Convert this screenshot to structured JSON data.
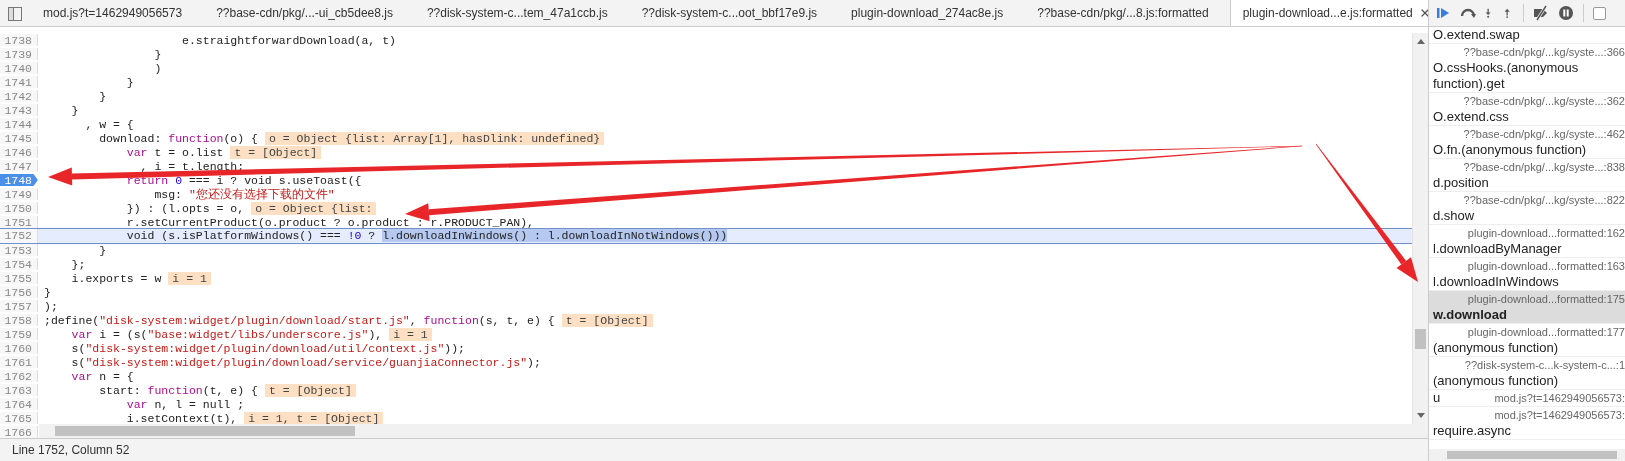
{
  "tabs": [
    {
      "label": "mod.js?t=1462949056573",
      "selected": false
    },
    {
      "label": "??base-cdn/pkg/...-ui_cb5dee8.js",
      "selected": false
    },
    {
      "label": "??disk-system-c...tem_47a1ccb.js",
      "selected": false
    },
    {
      "label": "??disk-system-c...oot_bbf17e9.js",
      "selected": false
    },
    {
      "label": "plugin-download_274ac8e.js",
      "selected": false
    },
    {
      "label": "??base-cdn/pkg/...8.js:formatted",
      "selected": false
    },
    {
      "label": "plugin-download...e.js:formatted",
      "selected": true
    }
  ],
  "code_lines": [
    {
      "number": "1738",
      "breakpoint": false,
      "current": false,
      "segments": [
        {
          "kind": "text",
          "text": "                    e.straightforwardDownload(a, t)"
        }
      ]
    },
    {
      "number": "1739",
      "breakpoint": false,
      "current": false,
      "segments": [
        {
          "kind": "text",
          "text": "                }"
        }
      ]
    },
    {
      "number": "1740",
      "breakpoint": false,
      "current": false,
      "segments": [
        {
          "kind": "text",
          "text": "                )"
        }
      ]
    },
    {
      "number": "1741",
      "breakpoint": false,
      "current": false,
      "segments": [
        {
          "kind": "text",
          "text": "            }"
        }
      ]
    },
    {
      "number": "1742",
      "breakpoint": false,
      "current": false,
      "segments": [
        {
          "kind": "text",
          "text": "        }"
        }
      ]
    },
    {
      "number": "1743",
      "breakpoint": false,
      "current": false,
      "segments": [
        {
          "kind": "text",
          "text": "    }"
        }
      ]
    },
    {
      "number": "1744",
      "breakpoint": false,
      "current": false,
      "segments": [
        {
          "kind": "text",
          "text": "      , w = {"
        }
      ]
    },
    {
      "number": "1745",
      "breakpoint": false,
      "current": false,
      "segments": [
        {
          "kind": "text",
          "text": "        download: "
        },
        {
          "kind": "keyword",
          "text": "function"
        },
        {
          "kind": "text",
          "text": "(o) {"
        },
        {
          "kind": "value",
          "text": "o = Object {list: Array[1], hasDlink: undefined}"
        }
      ]
    },
    {
      "number": "1746",
      "breakpoint": false,
      "current": false,
      "segments": [
        {
          "kind": "keyword",
          "text": "            var"
        },
        {
          "kind": "text",
          "text": " t = o.list"
        },
        {
          "kind": "value",
          "text": "t = [Object]"
        }
      ]
    },
    {
      "number": "1747",
      "breakpoint": false,
      "current": false,
      "segments": [
        {
          "kind": "text",
          "text": "              , i = t.length;"
        }
      ]
    },
    {
      "number": "1748",
      "breakpoint": true,
      "current": false,
      "segments": [
        {
          "kind": "keyword",
          "text": "            return"
        },
        {
          "kind": "number",
          "text": " 0"
        },
        {
          "kind": "text",
          "text": " === i ? void s.useToast({"
        }
      ]
    },
    {
      "number": "1749",
      "breakpoint": false,
      "current": false,
      "segments": [
        {
          "kind": "text",
          "text": "                msg: "
        },
        {
          "kind": "string",
          "text": "\"您还没有选择下载的文件\""
        }
      ]
    },
    {
      "number": "1750",
      "breakpoint": false,
      "current": false,
      "segments": [
        {
          "kind": "text",
          "text": "            }) : (l.opts = o,"
        },
        {
          "kind": "value",
          "text": "o = Object {list:"
        }
      ]
    },
    {
      "number": "1751",
      "breakpoint": false,
      "current": false,
      "segments": [
        {
          "kind": "text",
          "text": "            r.setCurrentProduct(o.product ? o.product : r.PRODUCT_PAN),"
        }
      ]
    },
    {
      "number": "1752",
      "breakpoint": false,
      "current": true,
      "segments": [
        {
          "kind": "text",
          "text": "            void (s.isPlatformWindows() === "
        },
        {
          "kind": "number",
          "text": "!0"
        },
        {
          "kind": "text",
          "text": " ? "
        },
        {
          "kind": "selection",
          "text": "l.downloadInWindows() : l.downloadInNotWindows()))"
        }
      ]
    },
    {
      "number": "1753",
      "breakpoint": false,
      "current": false,
      "segments": [
        {
          "kind": "text",
          "text": "        }"
        }
      ]
    },
    {
      "number": "1754",
      "breakpoint": false,
      "current": false,
      "segments": [
        {
          "kind": "text",
          "text": "    };"
        }
      ]
    },
    {
      "number": "1755",
      "breakpoint": false,
      "current": false,
      "segments": [
        {
          "kind": "text",
          "text": "    i.exports = w"
        },
        {
          "kind": "value",
          "text": "i = 1"
        }
      ]
    },
    {
      "number": "1756",
      "breakpoint": false,
      "current": false,
      "segments": [
        {
          "kind": "text",
          "text": "}"
        }
      ]
    },
    {
      "number": "1757",
      "breakpoint": false,
      "current": false,
      "segments": [
        {
          "kind": "text",
          "text": ");"
        }
      ]
    },
    {
      "number": "1758",
      "breakpoint": false,
      "current": false,
      "segments": [
        {
          "kind": "text",
          "text": ";define("
        },
        {
          "kind": "string",
          "text": "\"disk-system:widget/plugin/download/start.js\""
        },
        {
          "kind": "text",
          "text": ", "
        },
        {
          "kind": "keyword",
          "text": "function"
        },
        {
          "kind": "text",
          "text": "(s, t, e) {"
        },
        {
          "kind": "value",
          "text": "t = [Object]"
        }
      ]
    },
    {
      "number": "1759",
      "breakpoint": false,
      "current": false,
      "segments": [
        {
          "kind": "keyword",
          "text": "    var"
        },
        {
          "kind": "text",
          "text": " i = (s("
        },
        {
          "kind": "string",
          "text": "\"base:widget/libs/underscore.js\""
        },
        {
          "kind": "text",
          "text": "),"
        },
        {
          "kind": "value",
          "text": "i = 1"
        }
      ]
    },
    {
      "number": "1760",
      "breakpoint": false,
      "current": false,
      "segments": [
        {
          "kind": "text",
          "text": "    s("
        },
        {
          "kind": "string",
          "text": "\"disk-system:widget/plugin/download/util/context.js\""
        },
        {
          "kind": "text",
          "text": "));"
        }
      ]
    },
    {
      "number": "1761",
      "breakpoint": false,
      "current": false,
      "segments": [
        {
          "kind": "text",
          "text": "    s("
        },
        {
          "kind": "string",
          "text": "\"disk-system:widget/plugin/download/service/guanjiaConnector.js\""
        },
        {
          "kind": "text",
          "text": ");"
        }
      ]
    },
    {
      "number": "1762",
      "breakpoint": false,
      "current": false,
      "segments": [
        {
          "kind": "keyword",
          "text": "    var"
        },
        {
          "kind": "text",
          "text": " n = {"
        }
      ]
    },
    {
      "number": "1763",
      "breakpoint": false,
      "current": false,
      "segments": [
        {
          "kind": "text",
          "text": "        start: "
        },
        {
          "kind": "keyword",
          "text": "function"
        },
        {
          "kind": "text",
          "text": "(t, e) {"
        },
        {
          "kind": "value",
          "text": "t = [Object]"
        }
      ]
    },
    {
      "number": "1764",
      "breakpoint": false,
      "current": false,
      "segments": [
        {
          "kind": "keyword",
          "text": "            var"
        },
        {
          "kind": "text",
          "text": " n, l = null ;"
        }
      ]
    },
    {
      "number": "1765",
      "breakpoint": false,
      "current": false,
      "segments": [
        {
          "kind": "text",
          "text": "            i.setContext(t),"
        },
        {
          "kind": "value",
          "text": "i = 1, t = [Object]"
        }
      ]
    },
    {
      "number": "1766",
      "breakpoint": false,
      "current": false
    }
  ],
  "async_checkbox": {
    "checked": false
  },
  "status_bar": "Line 1752, Column 52",
  "call_stack": [
    {
      "name": "O.extend.swap",
      "selected": false
    },
    {
      "name": "O.cssHooks.(anonymous function).get",
      "location": "??base-cdn/pkg/...kg/syste...:366",
      "selected": false
    },
    {
      "name": "O.extend.css",
      "location": "??base-cdn/pkg/...kg/syste...:362",
      "selected": false
    },
    {
      "name": "O.fn.(anonymous function)",
      "location": "??base-cdn/pkg/...kg/syste...:462",
      "selected": false
    },
    {
      "name": "d.position",
      "location": "??base-cdn/pkg/...kg/syste...:838",
      "selected": false
    },
    {
      "name": "d.show",
      "location": "??base-cdn/pkg/...kg/syste...:822",
      "selected": false
    },
    {
      "name": "l.downloadByManager",
      "location": "plugin-download...formatted:162",
      "selected": false
    },
    {
      "name": "l.downloadInWindows",
      "location": "plugin-download...formatted:163",
      "selected": false
    },
    {
      "name": "w.download",
      "location": "plugin-download...formatted:175",
      "selected": true
    },
    {
      "name": "(anonymous function)",
      "location": "plugin-download...formatted:177",
      "selected": false
    },
    {
      "name": "(anonymous function)",
      "location": "??disk-system-c...k-system-c...:1",
      "selected": false
    },
    {
      "name": "u",
      "location": "mod.js?t=1462949056573:",
      "selected": false,
      "kind": "inline"
    },
    {
      "name": "require.async",
      "location": "mod.js?t=1462949056573:",
      "selected": false
    }
  ]
}
